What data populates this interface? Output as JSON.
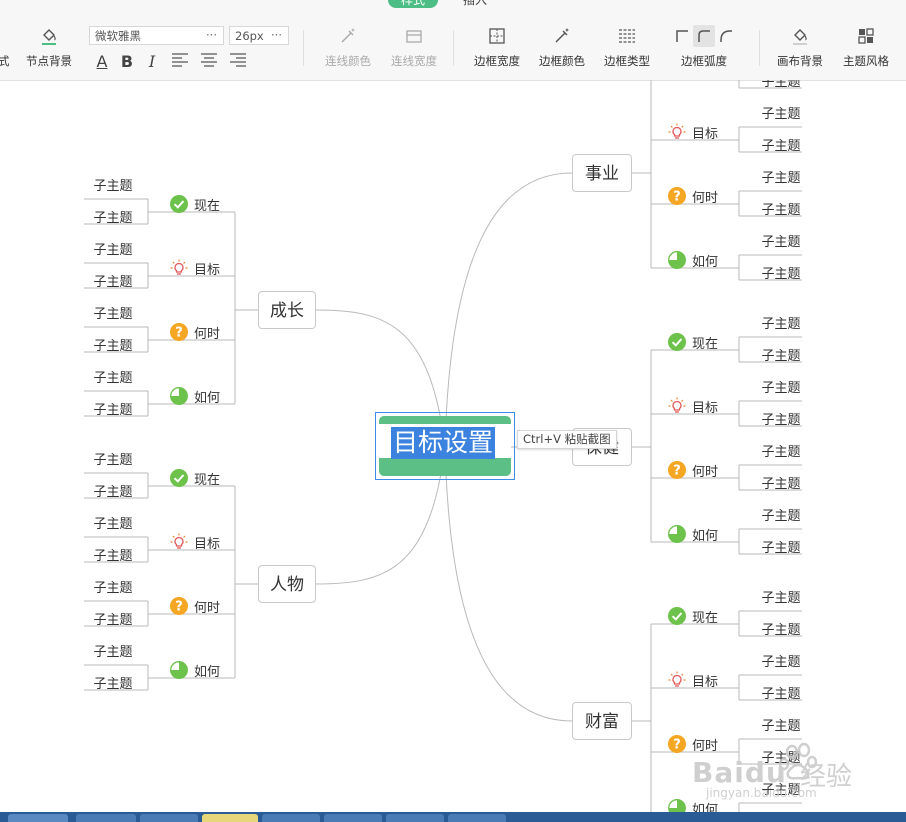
{
  "toolbar": {
    "tabs": {
      "style": "样式",
      "insert": "插入"
    },
    "partial_label": "式",
    "node_bg": "节点背景",
    "font_family": "微软雅黑",
    "font_size": "26px",
    "more": "···",
    "format_icons": {
      "font_color": "A",
      "bold": "B",
      "italic": "I"
    },
    "line_color": "连线颜色",
    "line_width": "连线宽度",
    "border_width": "边框宽度",
    "border_color": "边框颜色",
    "border_type": "边框类型",
    "border_radius": "边框弧度",
    "canvas_bg": "画布背景",
    "theme_style": "主题风格",
    "accent_color": "#4cbd85"
  },
  "mindmap": {
    "central": "目标设置",
    "central_color": "#5bbf86",
    "selection_color": "#3b83de",
    "paste_hint": "Ctrl+V 粘贴截图",
    "tags": {
      "now": "现在",
      "goal": "目标",
      "when": "何时",
      "how": "如何"
    },
    "subtopic": "子主题",
    "branches": {
      "career": "事业",
      "growth": "成长",
      "health": "保健",
      "people": "人物",
      "wealth": "财富"
    }
  },
  "watermark": {
    "brand": "Baidu",
    "cn": "经验",
    "url": "jingyan.baidu.com"
  }
}
